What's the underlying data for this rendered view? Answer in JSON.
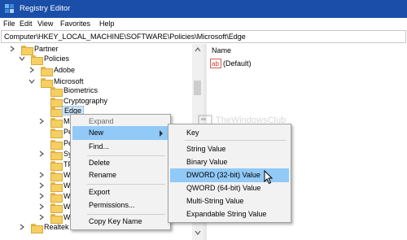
{
  "window": {
    "title": "Registry Editor"
  },
  "menu": [
    "File",
    "Edit",
    "View",
    "Favorites",
    "Help"
  ],
  "address": {
    "path": "Computer\\HKEY_LOCAL_MACHINE\\SOFTWARE\\Policies\\Microsoft\\Edge"
  },
  "tree": {
    "partner": "Partner",
    "policies": "Policies",
    "adobe": "Adobe",
    "microsoft": "Microsoft",
    "biometrics": "Biometrics",
    "cryptography": "Cryptography",
    "edge": "Edge",
    "truncated": [
      "Mi",
      "Pe",
      "Pe",
      "Sys",
      "TP",
      "Wi",
      "Wi",
      "Wi",
      "Wi",
      "Wi"
    ],
    "realtek": "Realtek"
  },
  "values": {
    "header": "Name",
    "rows": [
      {
        "name": "(Default)",
        "icon": "ab-string-icon"
      }
    ]
  },
  "watermark": {
    "text": "TheWindowsClub"
  },
  "context_menu": {
    "items": [
      "Expand",
      "New",
      "Find...",
      "Delete",
      "Rename",
      "Export",
      "Permissions...",
      "Copy Key Name"
    ],
    "disabled": "Expand"
  },
  "new_submenu": {
    "items": [
      "Key",
      "String Value",
      "Binary Value",
      "DWORD (32-bit) Value",
      "QWORD (64-bit) Value",
      "Multi-String Value",
      "Expandable String Value"
    ],
    "highlighted": "DWORD (32-bit) Value"
  },
  "colors": {
    "titlebar": "#1a4ea8",
    "highlight": "#91c9f7",
    "selected_node": "#cce4f7",
    "folder": "#f5cf62"
  }
}
